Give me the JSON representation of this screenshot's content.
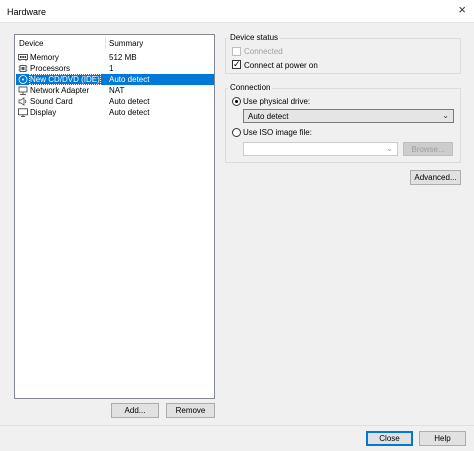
{
  "window": {
    "title": "Hardware"
  },
  "device_list": {
    "columns": {
      "device": "Device",
      "summary": "Summary"
    },
    "rows": [
      {
        "name": "Memory",
        "summary": "512 MB",
        "icon": "memory-icon"
      },
      {
        "name": "Processors",
        "summary": "1",
        "icon": "processor-icon"
      },
      {
        "name": "New CD/DVD (IDE)",
        "summary": "Auto detect",
        "icon": "cd-dvd-icon",
        "selected": true
      },
      {
        "name": "Network Adapter",
        "summary": "NAT",
        "icon": "network-adapter-icon"
      },
      {
        "name": "Sound Card",
        "summary": "Auto detect",
        "icon": "sound-card-icon"
      },
      {
        "name": "Display",
        "summary": "Auto detect",
        "icon": "display-icon"
      }
    ],
    "add_label": "Add...",
    "remove_label": "Remove"
  },
  "device_status": {
    "title": "Device status",
    "connected_label": "Connected",
    "connected_checked": false,
    "connected_enabled": false,
    "connect_power_on_label": "Connect at power on",
    "connect_power_on_checked": true
  },
  "connection": {
    "title": "Connection",
    "physical_drive_label": "Use physical drive:",
    "physical_drive_selected": true,
    "physical_drive_value": "Auto detect",
    "iso_label": "Use ISO image file:",
    "iso_selected": false,
    "iso_value": "",
    "browse_label": "Browse..."
  },
  "advanced_label": "Advanced...",
  "footer": {
    "close_label": "Close",
    "help_label": "Help"
  },
  "colors": {
    "selection": "#0078d7",
    "background": "#f0f0f0"
  }
}
